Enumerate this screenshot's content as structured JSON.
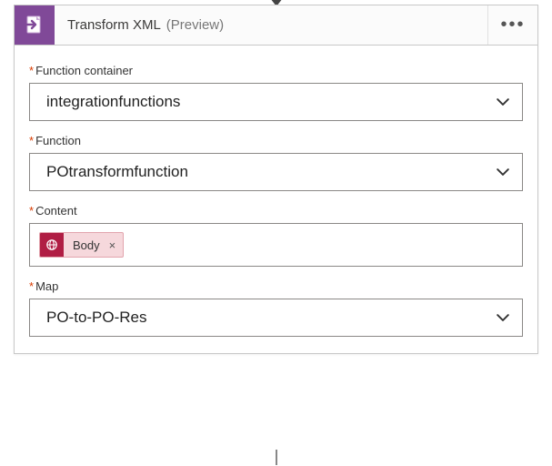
{
  "header": {
    "title": "Transform XML",
    "preview": "(Preview)"
  },
  "fields": {
    "functionContainer": {
      "label": "Function container",
      "value": "integrationfunctions"
    },
    "function": {
      "label": "Function",
      "value": "POtransformfunction"
    },
    "content": {
      "label": "Content",
      "token": "Body"
    },
    "map": {
      "label": "Map",
      "value": "PO-to-PO-Res"
    }
  }
}
